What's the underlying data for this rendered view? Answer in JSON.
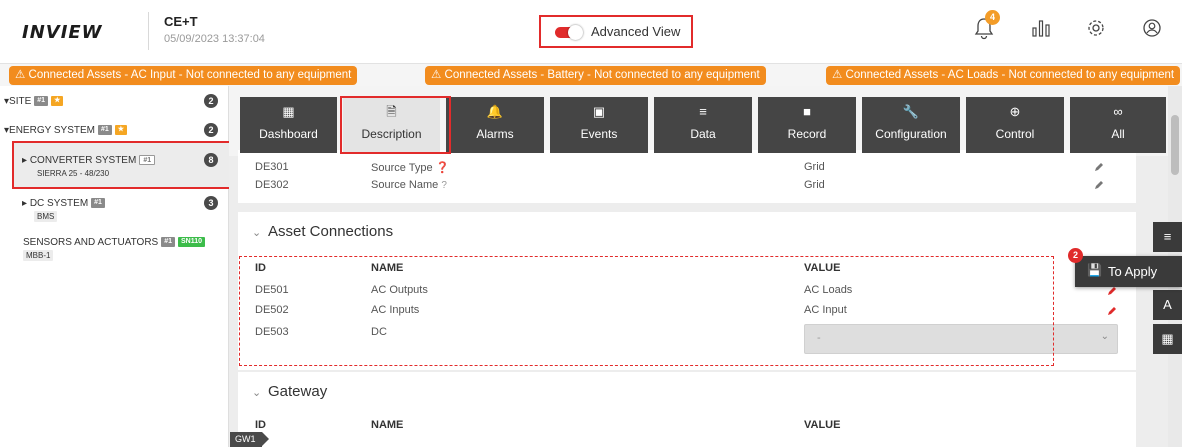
{
  "header": {
    "logo": "INVIEW",
    "app_name": "CE+T",
    "timestamp": "05/09/2023 13:37:04",
    "advanced_view_label": "Advanced View",
    "advanced_view_on": true,
    "bell_badge": "4",
    "icons": [
      "bell-icon",
      "chart-icon",
      "gear-icon",
      "user-icon"
    ]
  },
  "alerts": [
    "Connected Assets - AC Input - Not connected to any equipment",
    "Connected Assets - Battery - Not connected to any equipment",
    "Connected Assets - AC Loads - Not connected to any equipment"
  ],
  "sidebar": {
    "site": {
      "label": "SITE",
      "tag": "#1",
      "count": "2"
    },
    "energy_system": {
      "label": "ENERGY SYSTEM",
      "tag": "#1",
      "count": "2"
    },
    "converter_system": {
      "label": "CONVERTER SYSTEM",
      "tag": "#1",
      "sub": "SIERRA 25 - 48/230",
      "count": "8"
    },
    "dc_system": {
      "label": "DC SYSTEM",
      "tag": "#1",
      "sub": "BMS",
      "count": "3"
    },
    "sensors": {
      "label": "SENSORS AND ACTUATORS",
      "tag": "#1",
      "tag2": "SN110",
      "sub": "MBB-1"
    }
  },
  "nav": [
    {
      "label": "Dashboard",
      "icon": "dashboard-icon",
      "glyph": "▦"
    },
    {
      "label": "Description",
      "icon": "document-icon",
      "glyph": "🗎"
    },
    {
      "label": "Alarms",
      "icon": "alarm-icon",
      "glyph": "🔔"
    },
    {
      "label": "Events",
      "icon": "calendar-icon",
      "glyph": "▣"
    },
    {
      "label": "Data",
      "icon": "data-icon",
      "glyph": "≡"
    },
    {
      "label": "Record",
      "icon": "record-icon",
      "glyph": "■"
    },
    {
      "label": "Configuration",
      "icon": "wrench-icon",
      "glyph": "🔧"
    },
    {
      "label": "Control",
      "icon": "control-icon",
      "glyph": "⊕"
    },
    {
      "label": "All",
      "icon": "infinity-icon",
      "glyph": "∞"
    }
  ],
  "source_rows": [
    {
      "id": "DE301",
      "name": "Source Type",
      "value": "Grid"
    },
    {
      "id": "DE302",
      "name": "Source Name",
      "value": "Grid"
    }
  ],
  "asset_connections": {
    "title": "Asset Connections",
    "columns": {
      "id": "ID",
      "name": "NAME",
      "value": "VALUE"
    },
    "rows": [
      {
        "id": "DE501",
        "name": "AC Outputs",
        "value": "AC Loads"
      },
      {
        "id": "DE502",
        "name": "AC Inputs",
        "value": "AC Input"
      },
      {
        "id": "DE503",
        "name": "DC",
        "value": "-"
      }
    ]
  },
  "gateway": {
    "title": "Gateway",
    "columns": {
      "id": "ID",
      "name": "NAME",
      "value": "VALUE"
    },
    "tag": "GW1"
  },
  "to_apply": {
    "label": "To Apply",
    "count": "2"
  },
  "colors": {
    "accent": "#e22b2b",
    "warning": "#f28c1e",
    "nav_bg": "#454545"
  }
}
